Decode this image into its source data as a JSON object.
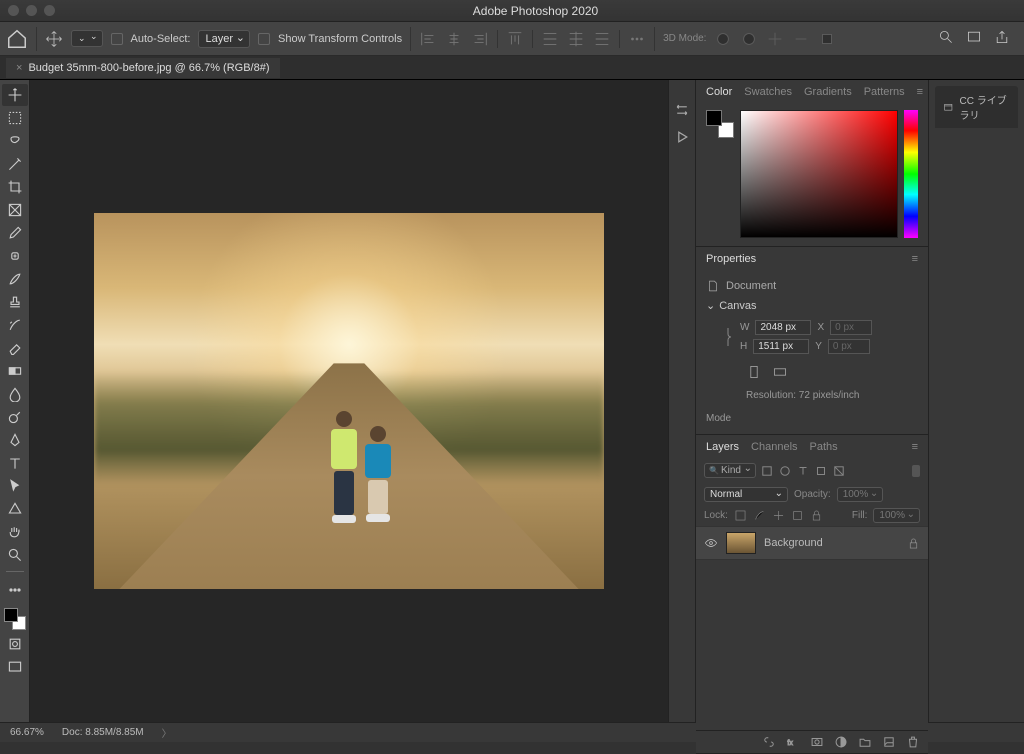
{
  "app": {
    "title": "Adobe Photoshop 2020"
  },
  "options": {
    "auto_select_label": "Auto-Select:",
    "layer_dd": "Layer",
    "show_transform": "Show Transform Controls",
    "mode3d": "3D Mode:"
  },
  "doc": {
    "tab_title": "Budget 35mm-800-before.jpg @ 66.7% (RGB/8#)",
    "zoom": "66.67%",
    "docsize": "Doc: 8.85M/8.85M"
  },
  "right_tabs": {
    "cc_library": "CC ライブラリ"
  },
  "panels": {
    "color": {
      "tabs": [
        "Color",
        "Swatches",
        "Gradients",
        "Patterns"
      ],
      "active": 0
    },
    "properties": {
      "tab": "Properties",
      "doc_label": "Document",
      "canvas_label": "Canvas",
      "w_label": "W",
      "w_value": "2048 px",
      "h_label": "H",
      "h_value": "1511 px",
      "x_label": "X",
      "x_value": "0 px",
      "y_label": "Y",
      "y_value": "0 px",
      "resolution": "Resolution: 72 pixels/inch",
      "mode_label": "Mode"
    },
    "layers": {
      "tabs": [
        "Layers",
        "Channels",
        "Paths"
      ],
      "active": 0,
      "kind": "Kind",
      "blend_mode": "Normal",
      "opacity_label": "Opacity:",
      "opacity_value": "100%",
      "lock_label": "Lock:",
      "fill_label": "Fill:",
      "fill_value": "100%",
      "layer_name": "Background"
    }
  }
}
